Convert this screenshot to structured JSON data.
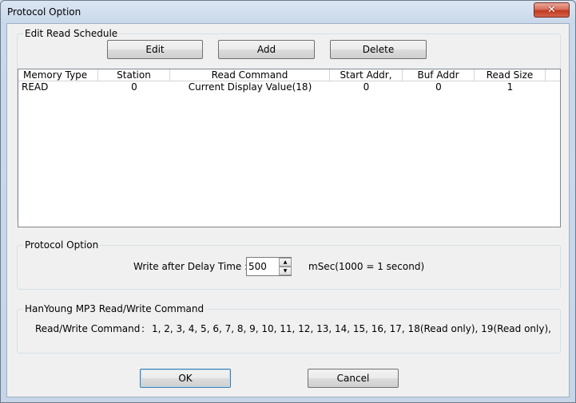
{
  "window": {
    "title": "Protocol Option",
    "close_label": "✕"
  },
  "edit_read_schedule": {
    "group_label": "Edit Read Schedule",
    "buttons": {
      "edit": "Edit",
      "add": "Add",
      "delete": "Delete"
    },
    "columns": [
      "Memory Type",
      "Station",
      "Read Command",
      "Start Addr,",
      "Buf Addr",
      "Read Size"
    ],
    "rows": [
      [
        "READ",
        "0",
        "Current Display Value(18)",
        "0",
        "0",
        "1"
      ]
    ]
  },
  "protocol_option": {
    "group_label": "Protocol Option",
    "delay_label": "Write after Delay Time :",
    "delay_value": "500",
    "delay_unit": "mSec(1000 = 1 second)"
  },
  "hanyoung": {
    "group_label": "HanYoung MP3 Read/Write Command",
    "command_label": "Read/Write Command",
    "command_sep": ":",
    "command_list": "1, 2, 3, 4, 5, 6, 7, 8, 9, 10, 11, 12, 13, 14, 15, 16, 17, 18(Read only), 19(Read only),"
  },
  "footer": {
    "ok_label": "OK",
    "cancel_label": "Cancel"
  }
}
